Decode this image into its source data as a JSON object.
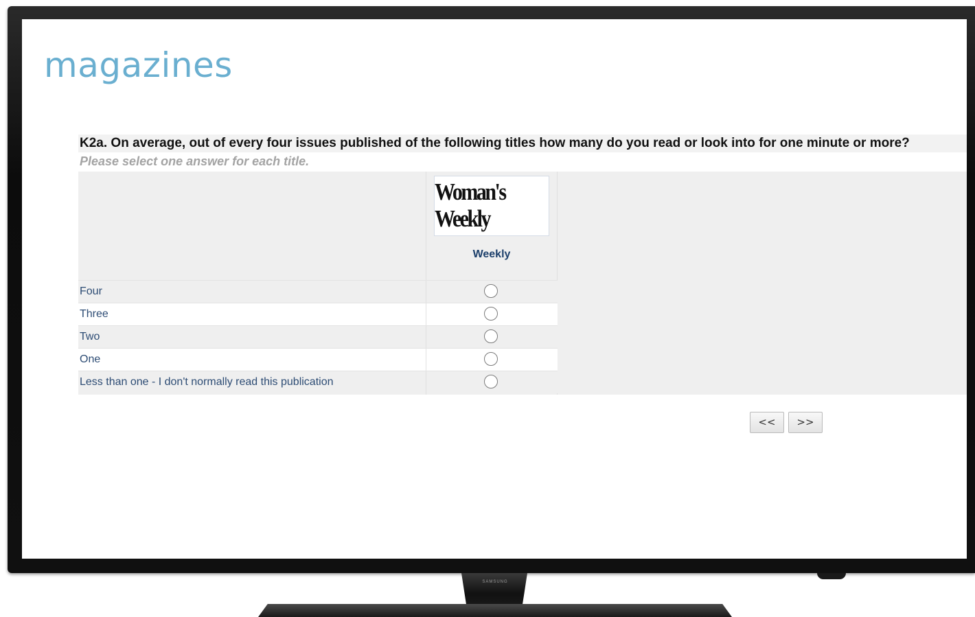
{
  "page": {
    "title": "magazines"
  },
  "question": {
    "text": "K2a. On average, out of every four issues published of the following titles how many do you read or look into for one minute or more?",
    "instruction": "Please select one answer for each title."
  },
  "publication": {
    "logo_text": "Woman's Weekly",
    "frequency": "Weekly"
  },
  "options": [
    {
      "label": "Four",
      "selected": false
    },
    {
      "label": "Three",
      "selected": false
    },
    {
      "label": "Two",
      "selected": false
    },
    {
      "label": "One",
      "selected": false
    },
    {
      "label": "Less than one - I don't normally read this publication",
      "selected": false
    }
  ],
  "navigation": {
    "back_label": "<<",
    "next_label": ">>"
  },
  "device": {
    "brand": "SAMSUNG"
  },
  "colors": {
    "title": "#6aafd0",
    "option_text": "#2d4c74",
    "header_text": "#1c3f6b"
  }
}
